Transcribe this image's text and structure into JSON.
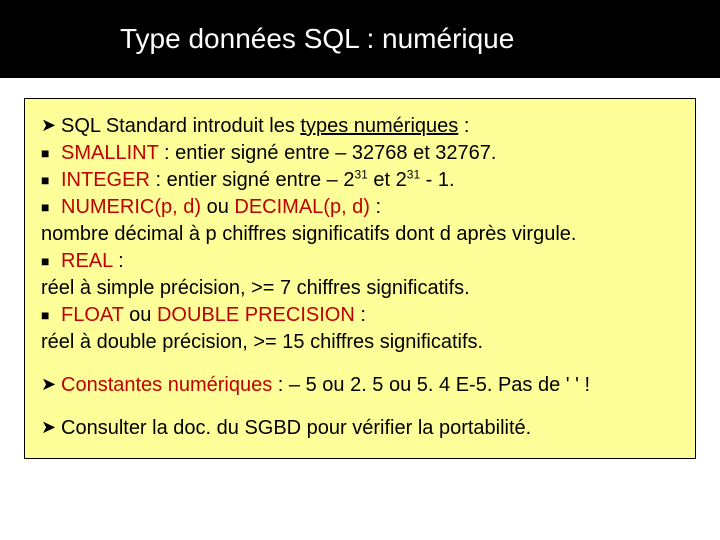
{
  "title": "Type données SQL : numérique",
  "intro": {
    "pre": "SQL Standard introduit les ",
    "ul": "types numériques",
    "post": " :"
  },
  "items": {
    "smallint": {
      "kw": "SMALLINT",
      "rest": " : entier signé entre – 32768 et 32767."
    },
    "integer": {
      "kw": "INTEGER",
      "pre": " : entier signé entre – 2",
      "e1": "31",
      "mid": " et 2",
      "e2": "31",
      "post": " - 1."
    },
    "numeric": {
      "kw1": "NUMERIC(p, d)",
      "ou": " ou ",
      "kw2": "DECIMAL(p, d)",
      "post": " :"
    },
    "numeric_desc": "nombre décimal à p chiffres significatifs dont d après virgule.",
    "real": {
      "kw": "REAL",
      "post": " :"
    },
    "real_desc": "réel à simple précision, >= 7 chiffres significatifs.",
    "float": {
      "kw1": "FLOAT",
      "ou": " ou ",
      "kw2": "DOUBLE PRECISION",
      "post": " :"
    },
    "float_desc": "réel à double précision, >= 15 chiffres significatifs."
  },
  "const": {
    "kw": "Constantes numériques",
    "rest": " : – 5 ou 2. 5 ou 5. 4 E-5. Pas de ' ' !"
  },
  "doc": "Consulter la doc. du SGBD pour vérifier la portabilité."
}
